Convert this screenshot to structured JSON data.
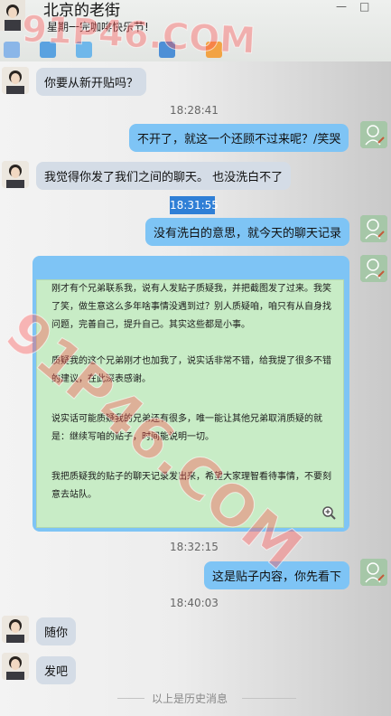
{
  "header": {
    "contact_name": "北京的老街",
    "signature": "星期一完咖啡快乐节!"
  },
  "watermark": "91P46.COM",
  "messages": [
    {
      "side": "left",
      "text": "你要从新开贴吗？"
    },
    {
      "time": "18:28:41"
    },
    {
      "side": "right",
      "text": "不开了，就这一个还顾不过来呢？/笑哭"
    },
    {
      "side": "left",
      "text": "我觉得你发了我们之间的聊天。 也没洗白不了"
    },
    {
      "time": "18:31:55"
    },
    {
      "side": "right",
      "text": "没有洗白的意思，就今天的聊天记录"
    },
    {
      "side": "right",
      "type": "image"
    },
    {
      "time": "18:32:15"
    },
    {
      "side": "right",
      "text": "这是贴子内容，你先看下"
    },
    {
      "time": "18:40:03"
    },
    {
      "side": "left",
      "text": "随你"
    },
    {
      "side": "left",
      "text": "发吧"
    }
  ],
  "image_text": {
    "p1": "刚才有个兄弟联系我，说有人发贴子质疑我，并把截图发了过来。我笑了笑，做生意这么多年啥事情没遇到过？别人质疑咱，咱只有从自身找问题，完善自己，提升自己。其实这些都是小事。",
    "p2": "质疑我的这个兄弟刚才也加我了，说实话非常不错，给我提了很多不错的建议，在此深表感谢。",
    "p3": "说实话可能质疑我的兄弟还有很多，唯一能让其他兄弟取消质疑的就是：继续写咱的贴子，时间能说明一切。",
    "p4": "我把质疑我的贴子的聊天记录发出来，希望大家理智看待事情，不要刻意去站队。"
  },
  "footer": {
    "history_label": "以上是历史消息"
  },
  "colors": {
    "incoming_bubble": "#d4dce6",
    "outgoing_bubble": "#7ec4f5",
    "image_bg": "#c8ecc6"
  },
  "icons": [
    "contact-avatar",
    "mic-icon",
    "video-icon",
    "screen-share-icon",
    "file-icon",
    "app-icon",
    "minimize-icon",
    "maximize-icon",
    "zoom-icon",
    "self-avatar"
  ]
}
